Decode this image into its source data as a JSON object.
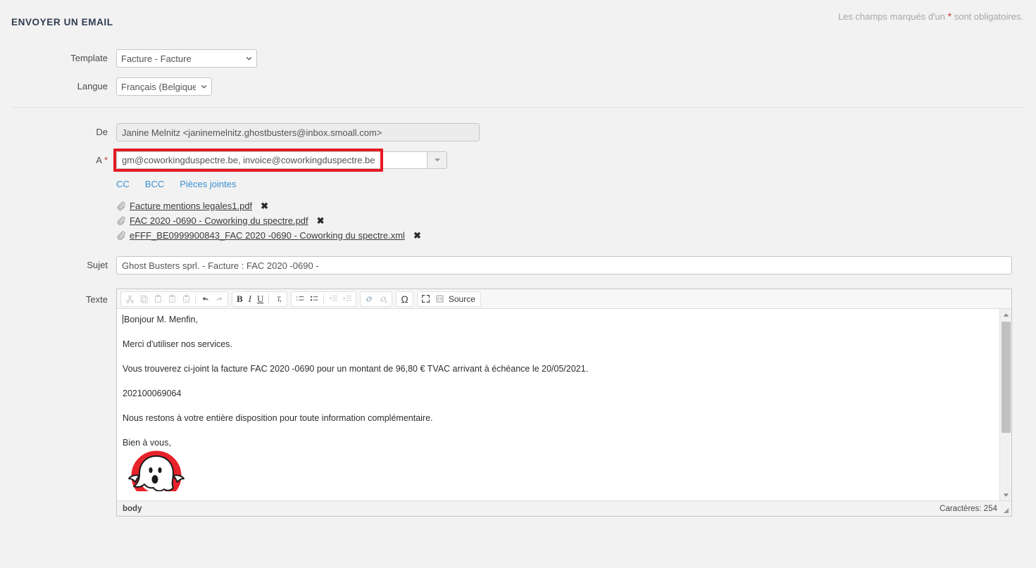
{
  "header": {
    "title": "ENVOYER UN EMAIL",
    "required_note_prefix": "Les champs marqués d'un",
    "required_star": "*",
    "required_note_suffix": "sont obligatoires."
  },
  "form": {
    "template": {
      "label": "Template",
      "value": "Facture - Facture"
    },
    "langue": {
      "label": "Langue",
      "value": "Français (Belgique)"
    },
    "de": {
      "label": "De",
      "value": "Janine Melnitz <janinemelnitz.ghostbusters@inbox.smoall.com>"
    },
    "a": {
      "label": "A",
      "required_star": "*",
      "value": "gm@coworkingduspectre.be, invoice@coworkingduspectre.be",
      "secondary_value": "",
      "highlight_color": "#e51b24"
    },
    "links": [
      {
        "name": "cc",
        "label": "CC"
      },
      {
        "name": "bcc",
        "label": "BCC"
      },
      {
        "name": "attachments",
        "label": "Pièces jointes"
      }
    ],
    "attachments": [
      {
        "name": "Facture mentions legales1.pdf",
        "remove": "✖"
      },
      {
        "name": "FAC 2020 -0690 - Coworking du spectre.pdf",
        "remove": "✖"
      },
      {
        "name": "eFFF_BE0999900843_FAC 2020 -0690 - Coworking du spectre.xml",
        "remove": "✖"
      }
    ],
    "sujet": {
      "label": "Sujet",
      "value": "Ghost Busters sprl. - Facture : FAC 2020 -0690 -"
    },
    "texte": {
      "label": "Texte"
    }
  },
  "editor": {
    "toolbar": {
      "cut": "cut-icon",
      "copy": "copy-icon",
      "paste": "paste-icon",
      "paste_text": "paste-text-icon",
      "paste_word": "paste-from-word-icon",
      "undo": "undo-icon",
      "redo": "redo-icon",
      "bold": "B",
      "italic": "I",
      "underline": "U",
      "remove_format": "remove-format-icon",
      "numbered_list": "numbered-list-icon",
      "bulleted_list": "bulleted-list-icon",
      "outdent": "outdent-icon",
      "indent": "indent-icon",
      "link": "link-icon",
      "unlink": "unlink-icon",
      "special_char": "Ω",
      "maximize": "maximize-icon",
      "source": "Source"
    },
    "body_paragraphs": [
      "Bonjour M. Menfin,",
      "Merci d'utiliser nos services.",
      "Vous trouverez ci-joint la facture FAC 2020 -0690 pour un montant de 96,80 € TVAC arrivant à échéance le 20/05/2021.",
      "202100069064",
      "Nous restons à votre entière disposition pour toute information complémentaire.",
      "Bien à vous,"
    ],
    "signature_logo": "ghostbusters-logo",
    "footer": {
      "element_path": "body",
      "char_count": "Caractères: 254"
    }
  }
}
